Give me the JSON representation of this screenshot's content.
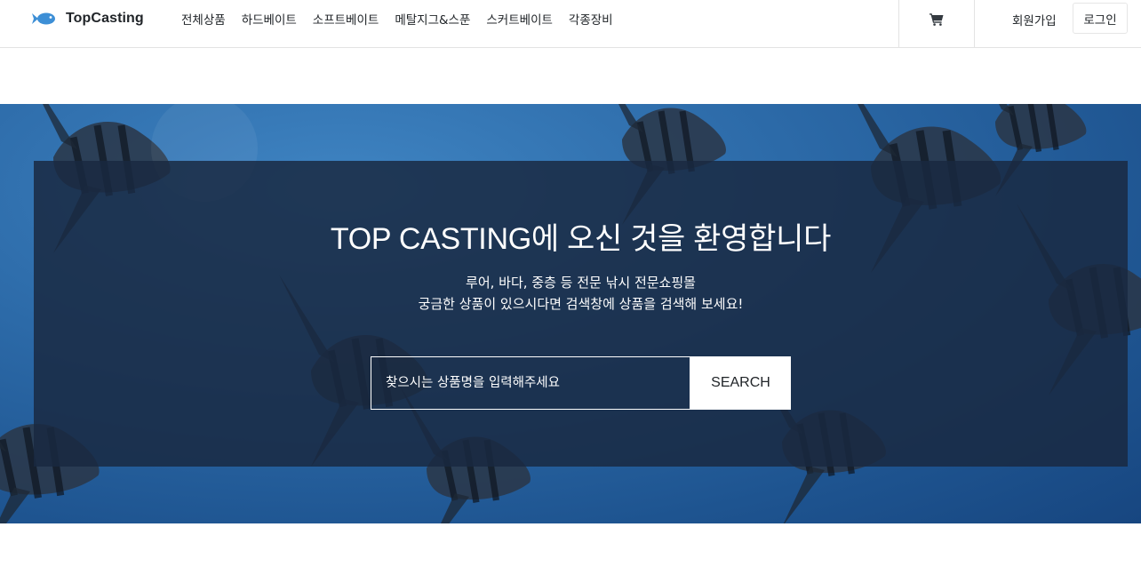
{
  "header": {
    "brand_name": "TopCasting",
    "logo_icon": "fish-icon",
    "nav_items": [
      "전체상품",
      "하드베이트",
      "소프트베이트",
      "메탈지그&스푼",
      "스커트베이트",
      "각종장비"
    ],
    "cart_icon": "cart-icon",
    "signup_label": "회원가입",
    "login_label": "로그인"
  },
  "hero": {
    "title": "TOP CASTING에 오신 것을 환영합니다",
    "subtitle_line1": "루어, 바다, 중층 등 전문 낚시 전문쇼핑몰",
    "subtitle_line2": "궁금한 상품이 있으시다면 검색창에 상품을 검색해 보세요!",
    "search_placeholder": "찾으시는 상품명을 입력해주세요",
    "search_button": "SEARCH"
  },
  "colors": {
    "overlay": "#1e2d44",
    "hero_blue": "#2c6aa8",
    "logo_blue": "#3d8fd6"
  }
}
